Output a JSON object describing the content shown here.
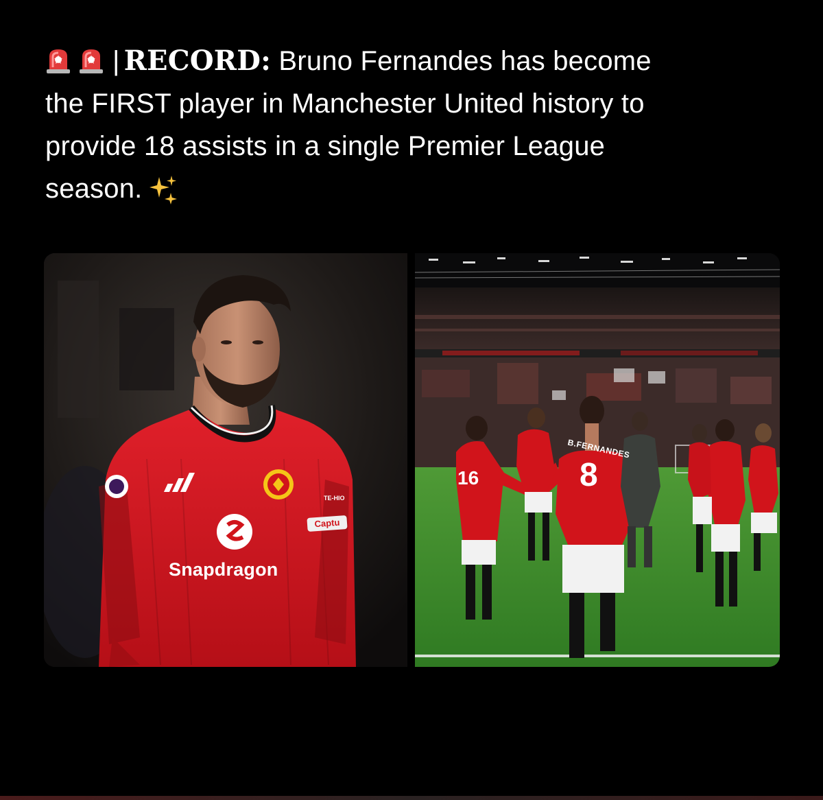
{
  "post": {
    "record_label": "RECORD:",
    "separator": "|",
    "text_line1": " Bruno Fernandes has become",
    "text_line2": "the FIRST player in Manchester United history to",
    "text_line3": "provide 18 assists in a single Premier League",
    "text_line4": "season.",
    "icons": [
      "siren-icon",
      "siren-icon",
      "sparkles-icon"
    ]
  },
  "left_photo": {
    "shirt_sponsor": "Snapdragon",
    "armband_text": "Captu",
    "sleeve_text": "TE-HIO"
  },
  "right_photo": {
    "player_name": "B.FERNANDES",
    "player_number": "8",
    "teammate_number": "16"
  },
  "colors": {
    "background": "#000000",
    "text": "#ffffff",
    "united_red": "#d1141b",
    "pitch_green": "#3f8a2c"
  }
}
